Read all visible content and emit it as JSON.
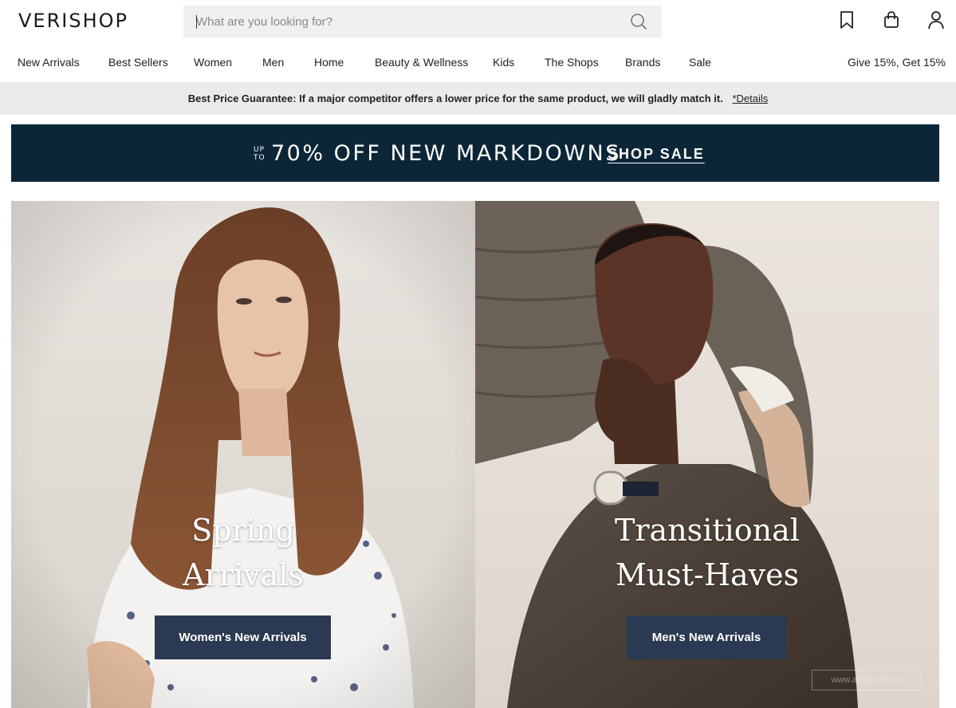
{
  "header": {
    "logo": "VERISHOP",
    "search_placeholder": "What are you looking for?",
    "icons": [
      "bookmark-icon",
      "shopping-bag-icon",
      "user-icon"
    ]
  },
  "nav": {
    "items": [
      "New Arrivals",
      "Best Sellers",
      "Women",
      "Men",
      "Home",
      "Beauty & Wellness",
      "Kids",
      "The Shops",
      "Brands",
      "Sale"
    ],
    "right": "Give 15%, Get 15%"
  },
  "guarantee": {
    "lead": "Best Price Guarantee:",
    "text": "If a major competitor offers a lower price for the same product, we will gladly match it.",
    "link": "*Details"
  },
  "promo": {
    "up": "UP",
    "to": "TO",
    "text": "70% OFF NEW MARKDOWNS",
    "link": "SHOP SALE",
    "background": "#0c2638"
  },
  "hero": {
    "left": {
      "title_line1": "Spring",
      "title_line2": "Arrivals",
      "button": "Women's New Arrivals"
    },
    "right": {
      "title_line1": "Transitional",
      "title_line2": "Must-Haves",
      "button": "Men's New Arrivals"
    },
    "button_color": "#2b3a52"
  },
  "watermark": "www.amz123.com"
}
